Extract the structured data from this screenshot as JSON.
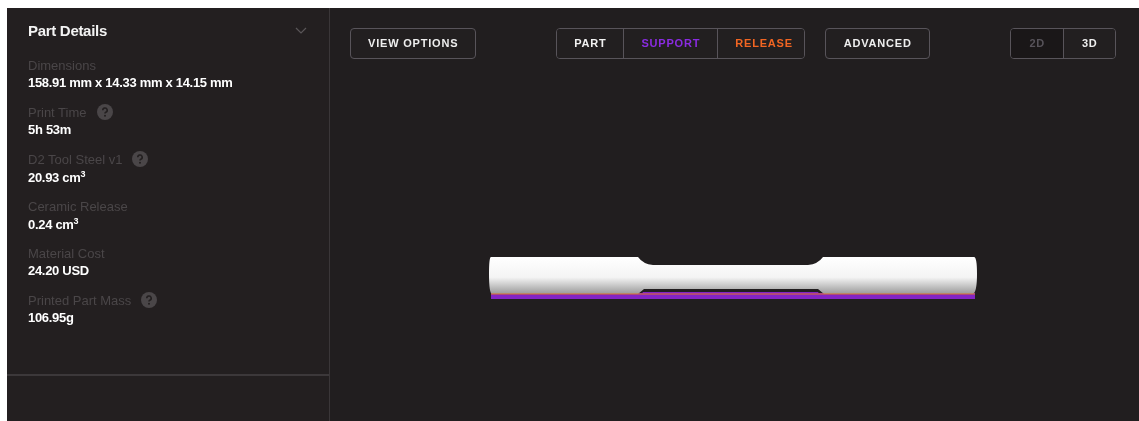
{
  "sidebar": {
    "title": "Part Details",
    "expanded": true,
    "details": [
      {
        "label": "Dimensions",
        "value": "158.91 mm x 14.33 mm x 14.15 mm",
        "help": false
      },
      {
        "label": "Print Time",
        "value": "5h 53m",
        "help": true
      },
      {
        "label": "D2 Tool Steel v1",
        "value": "20.93 cm$^{3}$",
        "help": true
      },
      {
        "label": "Ceramic Release",
        "value": "0.24 cm$^{3}$",
        "help": false
      },
      {
        "label": "Material Cost",
        "value": "24.20 USD",
        "help": false
      },
      {
        "label": "Printed Part Mass",
        "value": "106.95g",
        "help": true
      }
    ]
  },
  "toolbar": {
    "view_options": "VIEW OPTIONS",
    "layers": [
      {
        "label": "PART",
        "color": "#f2f2f2"
      },
      {
        "label": "SUPPORT",
        "color": "#8a2be2"
      },
      {
        "label": "RELEASE",
        "color": "#f26522"
      }
    ],
    "advanced": "ADVANCED",
    "views": [
      {
        "label": "2D",
        "selected": false
      },
      {
        "label": "3D",
        "selected": true
      }
    ]
  }
}
